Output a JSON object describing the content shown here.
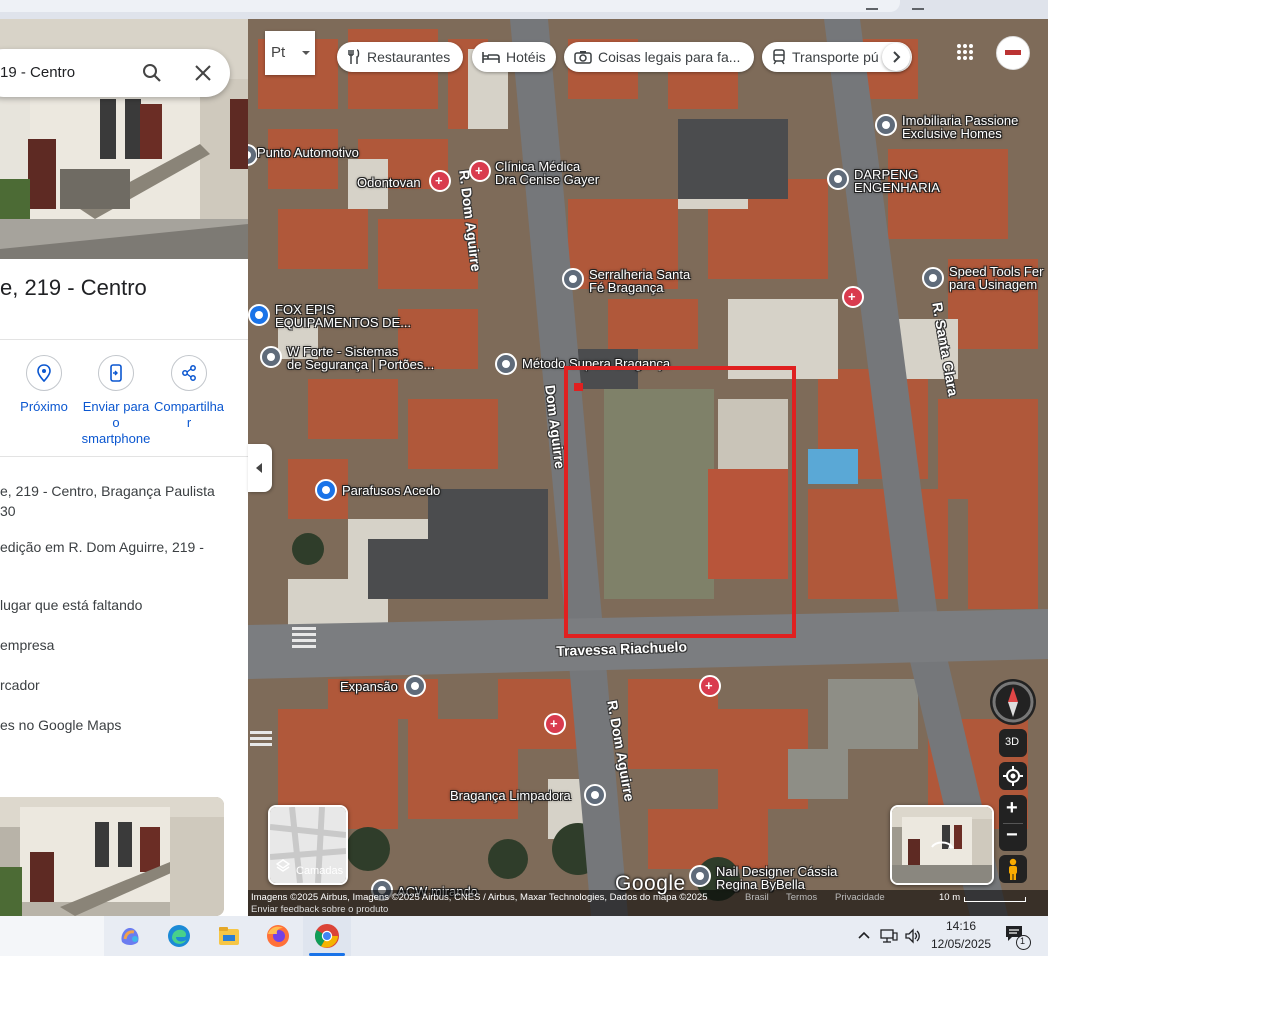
{
  "search": {
    "query": "19 - Centro"
  },
  "place": {
    "title": "e, 219 - Centro",
    "actions": [
      {
        "label": "Próximo"
      },
      {
        "label": "Enviar para o smartphone",
        "lines": [
          "Enviar para",
          "o",
          "smartphone"
        ]
      },
      {
        "label": "Compartilhar",
        "lines": [
          "Compartilha",
          "r"
        ]
      }
    ],
    "address_line1": "e, 219 - Centro, Bragança Paulista",
    "address_line2": "30",
    "edit_line1": "edição em R. Dom Aguirre, 219 -",
    "missing_place": "lugar que está faltando",
    "business": "empresa",
    "marker": "rcador",
    "maps_places": "es no Google Maps"
  },
  "map": {
    "view_toggle": "Pt",
    "chips": [
      {
        "label": "Restaurantes",
        "icon": "fork-knife-icon"
      },
      {
        "label": "Hotéis",
        "icon": "bed-icon"
      },
      {
        "label": "Coisas legais para fa...",
        "icon": "camera-icon"
      },
      {
        "label": "Transporte pú",
        "icon": "train-icon"
      }
    ],
    "pois": [
      {
        "name": "Punto Automotivo",
        "color": "#5f6b7a",
        "kind": "dot"
      },
      {
        "name": "Odontovan",
        "color": "#d93b4e",
        "kind": "med"
      },
      {
        "name": "Clínica Médica Dra Cenise Gayer",
        "lines": [
          "Clínica Médica",
          "Dra Cenise Gayer"
        ],
        "color": "#d93b4e",
        "kind": "med"
      },
      {
        "name": "Imobiliaria Passione Exclusive Homes",
        "lines": [
          "Imobiliaria Passione",
          "Exclusive Homes"
        ],
        "color": "#5f6b7a",
        "kind": "dot"
      },
      {
        "name": "DARPENG ENGENHARIA",
        "lines": [
          "DARPENG",
          "ENGENHARIA"
        ],
        "color": "#5f6b7a",
        "kind": "dot"
      },
      {
        "name": "Serralheria Santa Fé Bragança",
        "lines": [
          "Serralheria Santa",
          "Fé Bragança"
        ],
        "color": "#5f6b7a",
        "kind": "dot"
      },
      {
        "name": "Speed Tools Fer para Usinagem",
        "lines": [
          "Speed Tools Fer",
          "para Usinagem"
        ],
        "color": "#5f6b7a",
        "kind": "dot"
      },
      {
        "name": "FOX EPIS EQUIPAMENTOS DE...",
        "lines": [
          "FOX EPIS",
          "EQUIPAMENTOS DE..."
        ],
        "color": "#1a73e8",
        "kind": "shop"
      },
      {
        "name": "W Forte - Sistemas de Segurança | Portões...",
        "lines": [
          "W Forte - Sistemas",
          "de Segurança | Portões..."
        ],
        "color": "#5f6b7a",
        "kind": "dot"
      },
      {
        "name": "Método Supera Bragança",
        "color": "#5f6b7a",
        "kind": "edu"
      },
      {
        "name": "Parafusos Acedo",
        "color": "#1a73e8",
        "kind": "shop"
      },
      {
        "name": "Expansão",
        "color": "#5f6b7a",
        "kind": "edu"
      },
      {
        "name": "Bragança Limpadora",
        "color": "#5f6b7a",
        "kind": "dot"
      },
      {
        "name": "Nail Designer Cássia Regina ByBella",
        "lines": [
          "Nail Designer Cássia",
          "Regina ByBella"
        ],
        "color": "#5f6b7a",
        "kind": "dot"
      },
      {
        "name": "ACW mirando",
        "color": "#5f6b7a",
        "kind": "dot"
      }
    ],
    "streets": {
      "dom_aguirre_north": "R. Dom Aguirre",
      "dom_aguirre_mid": "Dom Aguirre",
      "dom_aguirre_south": "R. Dom Aguirre",
      "santa_clara": "R. Santa Clara",
      "riachuelo": "Travessa Riachuelo"
    },
    "controls": {
      "three_d": "3D",
      "zoom_in": "+",
      "zoom_out": "−",
      "layers": "Camadas"
    },
    "attribution": "Imagens ©2025 Airbus, Imagens ©2025 Airbus, CNES / Airbus, Maxar Technologies, Dados do mapa ©2025",
    "footer_links": [
      "Brasil",
      "Termos",
      "Privacidade"
    ],
    "scale": "10 m",
    "feedback": "Enviar feedback sobre o produto",
    "google": "Google",
    "colors": {
      "highlight": "#e02020",
      "medical": "#d93b4e",
      "shop": "#1a73e8",
      "generic": "#5f6b7a"
    }
  },
  "taskbar": {
    "time": "14:16",
    "date": "12/05/2025",
    "notification_count": "1"
  }
}
